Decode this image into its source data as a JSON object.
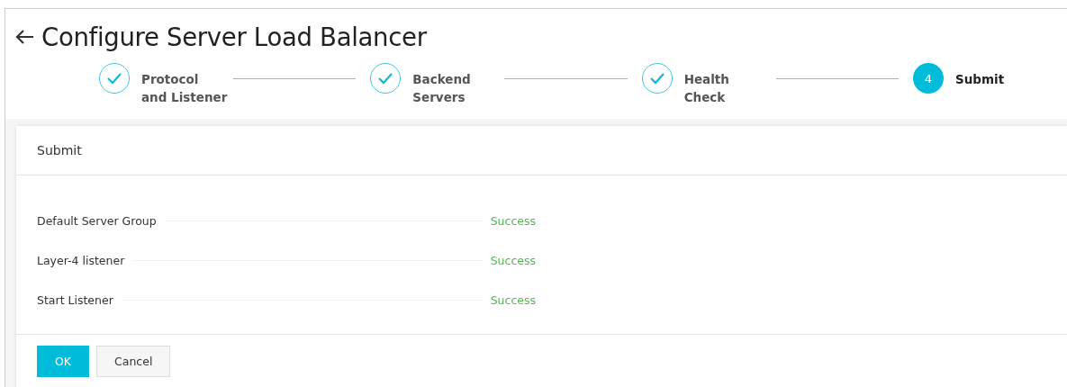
{
  "page": {
    "title": "Configure Server Load Balancer"
  },
  "steps": [
    {
      "completed": true,
      "label_lines": [
        "Protocol",
        "and Listener"
      ]
    },
    {
      "completed": true,
      "label_lines": [
        "Backend",
        "Servers"
      ]
    },
    {
      "completed": true,
      "label_lines": [
        "Health",
        "Check"
      ]
    },
    {
      "completed": false,
      "number": "4",
      "label_lines": [
        "Submit"
      ]
    }
  ],
  "card": {
    "title": "Submit",
    "tasks": [
      {
        "name": "Default Server Group",
        "result": "Success"
      },
      {
        "name": "Layer-4 listener",
        "result": "Success"
      },
      {
        "name": "Start Listener",
        "result": "Success"
      }
    ],
    "buttons": [
      {
        "label": "OK",
        "kind": "primary"
      },
      {
        "label": "Cancel",
        "kind": "secondary"
      }
    ]
  }
}
